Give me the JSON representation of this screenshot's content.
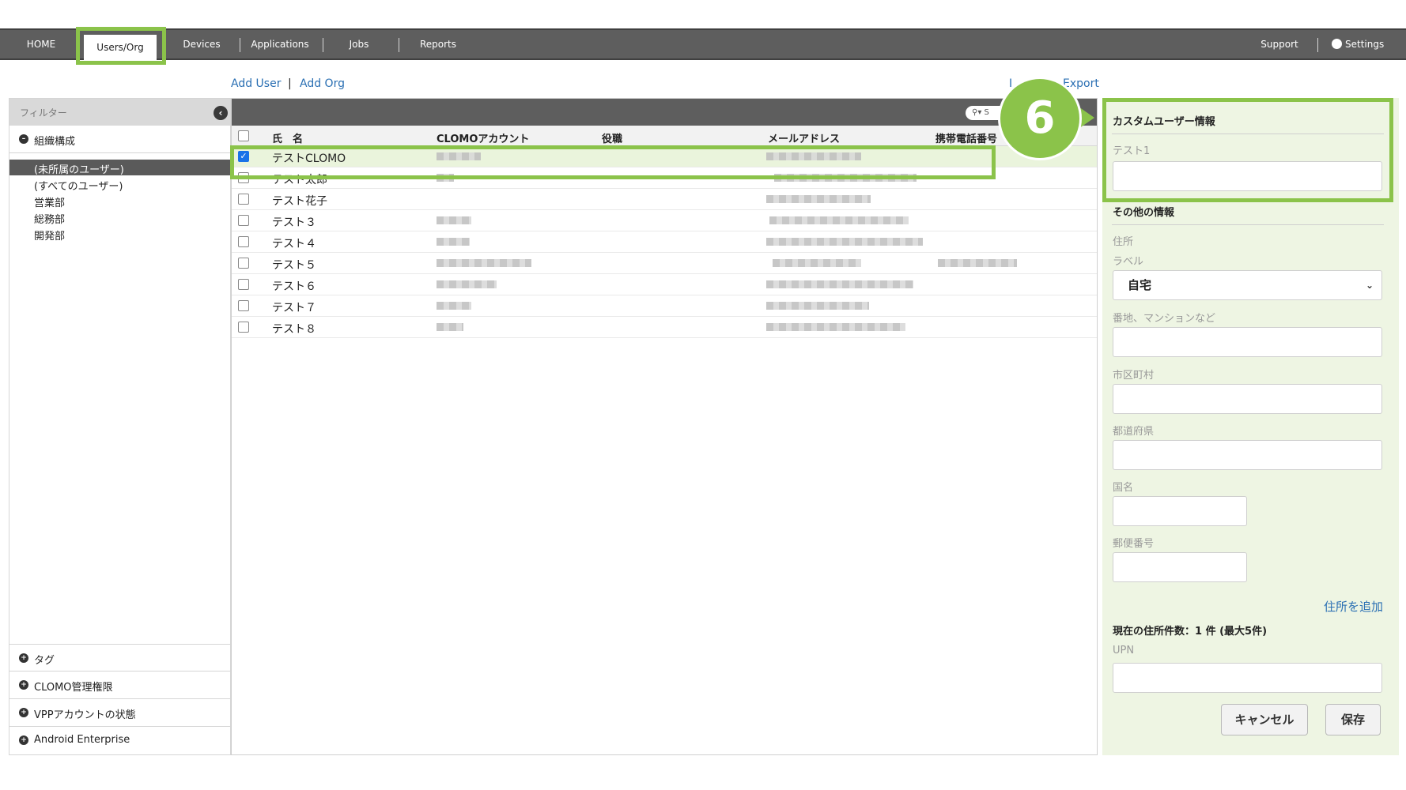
{
  "nav": {
    "items": [
      {
        "label": "HOME"
      },
      {
        "label": "Users/Org",
        "active": true
      },
      {
        "label": "Devices"
      },
      {
        "label": "Applications"
      },
      {
        "label": "Jobs"
      },
      {
        "label": "Reports"
      }
    ],
    "support": "Support",
    "settings": "Settings"
  },
  "actions": {
    "add_user": "Add User",
    "separator": "|",
    "add_org": "Add Org",
    "import": "I",
    "export": "Export"
  },
  "filter": {
    "title": "フィルター",
    "org_section": "組織構成",
    "orgs": [
      "(未所属のユーザー)",
      "(すべてのユーザー)",
      "営業部",
      "総務部",
      "開発部"
    ],
    "selected_org": "(未所属のユーザー)",
    "bottom_sections": [
      "タグ",
      "CLOMO管理権限",
      "VPPアカウントの状態",
      "Android Enterprise"
    ]
  },
  "table": {
    "search_placeholder": "S",
    "columns": [
      "氏　名",
      "CLOMOアカウント",
      "役職",
      "メールアドレス",
      "携帯電話番号"
    ],
    "rows": [
      {
        "name": "テストCLOMO",
        "checked": true
      },
      {
        "name": "テスト太郎",
        "checked": false
      },
      {
        "name": "テスト花子",
        "checked": false
      },
      {
        "name": "テスト３",
        "checked": false
      },
      {
        "name": "テスト４",
        "checked": false
      },
      {
        "name": "テスト５",
        "checked": false
      },
      {
        "name": "テスト６",
        "checked": false
      },
      {
        "name": "テスト７",
        "checked": false
      },
      {
        "name": "テスト８",
        "checked": false
      }
    ]
  },
  "panel": {
    "custom_title": "カスタムユーザー情報",
    "custom_field_label": "テスト1",
    "other_title": "その他の情報",
    "address_label": "住所",
    "label_label": "ラベル",
    "label_value": "自宅",
    "street_label": "番地、マンションなど",
    "city_label": "市区町村",
    "prefecture_label": "都道府県",
    "country_label": "国名",
    "postal_label": "郵便番号",
    "add_address": "住所を追加",
    "address_count": "現在の住所件数：1 件 (最大5件)",
    "upn_label": "UPN",
    "cancel": "キャンセル",
    "save": "保存"
  },
  "step_badge": "6",
  "accent_color": "#8bc34a"
}
